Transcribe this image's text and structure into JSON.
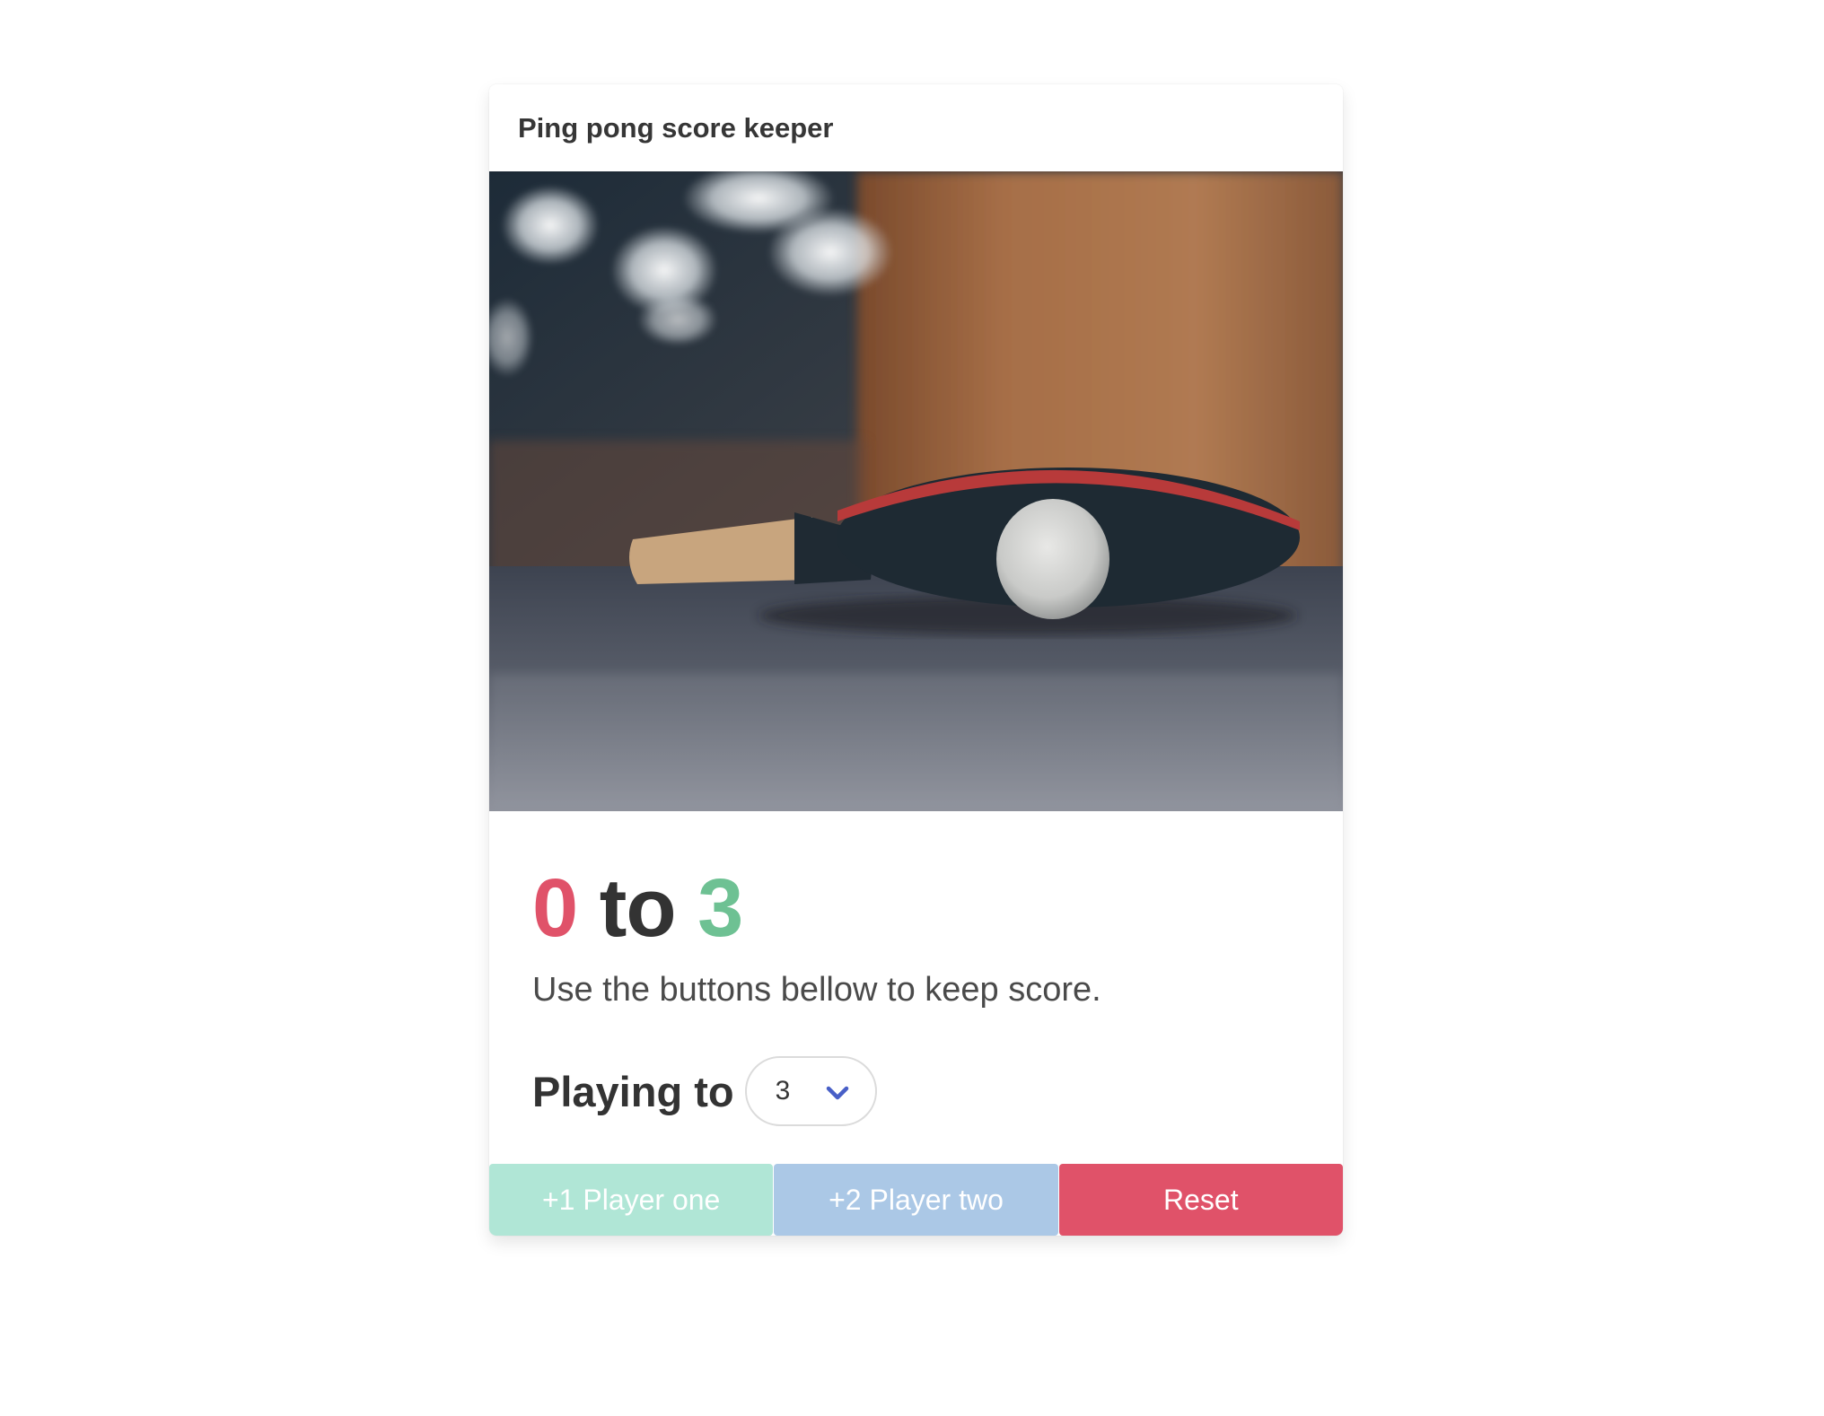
{
  "card": {
    "title": "Ping pong score keeper"
  },
  "score": {
    "player_one": "0",
    "separator": "to",
    "player_two": "3"
  },
  "subtitle": "Use the buttons bellow to keep score.",
  "playing_to": {
    "label": "Playing to",
    "selected": "3"
  },
  "buttons": {
    "player_one": "+1 Player one",
    "player_two": "+2 Player two",
    "reset": "Reset"
  },
  "colors": {
    "player_one": "#e05269",
    "player_two": "#6ec193",
    "button_player_one": "#b0e6d6",
    "button_player_two": "#abc8e6",
    "button_reset": "#e05269",
    "chevron": "#485fc7"
  },
  "image": {
    "subject": "ping-pong paddle with ball on table"
  }
}
